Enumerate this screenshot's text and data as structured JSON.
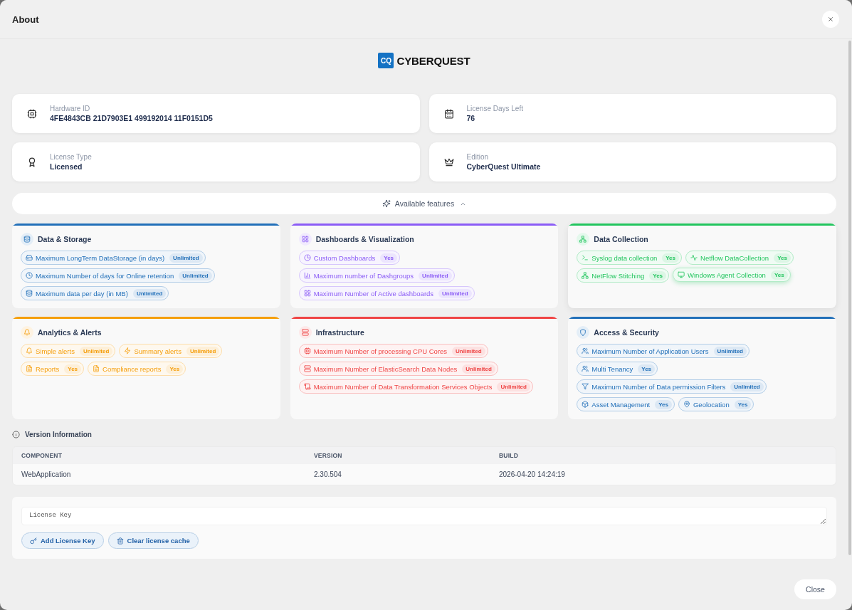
{
  "dialog": {
    "title": "About"
  },
  "logo": {
    "mark": "CQ",
    "name": "CYBERQUEST"
  },
  "info_cards": [
    {
      "kind": "chip",
      "label": "Hardware ID",
      "value": "4FE4843CB 21D7903E1 499192014 11F0151D5"
    },
    {
      "kind": "calendar",
      "label": "License Days Left",
      "value": "76"
    },
    {
      "kind": "ribbon",
      "label": "License Type",
      "value": "Licensed"
    },
    {
      "kind": "crown",
      "label": "Edition",
      "value": "CyberQuest Ultimate"
    }
  ],
  "features_toggle": {
    "label": "Available features",
    "expanded": true
  },
  "categories": [
    {
      "title": "Data & Storage",
      "kind": "database",
      "color": "#2270b9",
      "hovered": false,
      "features": [
        {
          "kind": "drive",
          "name": "Maximum LongTerm DataStorage (in days)",
          "value": "Unlimited",
          "hovered": false
        },
        {
          "kind": "clock",
          "name": "Maximum Number of days for Online retention",
          "value": "Unlimited",
          "hovered": false
        },
        {
          "kind": "database",
          "name": "Maximum data per day (in MB)",
          "value": "Unlimited",
          "hovered": false
        }
      ]
    },
    {
      "title": "Dashboards & Visualization",
      "kind": "grid",
      "color": "#8b5cf6",
      "hovered": false,
      "features": [
        {
          "kind": "pie",
          "name": "Custom Dashboards",
          "value": "Yes",
          "hovered": false
        },
        {
          "kind": "bars",
          "name": "Maximum number of Dashgroups",
          "value": "Unlimited",
          "hovered": false
        },
        {
          "kind": "grid",
          "name": "Maximum Number of Active dashboards",
          "value": "Unlimited",
          "hovered": false
        }
      ]
    },
    {
      "title": "Data Collection",
      "kind": "network",
      "color": "#22c55e",
      "hovered": true,
      "features": [
        {
          "kind": "terminal",
          "name": "Syslog data collection",
          "value": "Yes",
          "hovered": false
        },
        {
          "kind": "pulse",
          "name": "Netflow DataCollection",
          "value": "Yes",
          "hovered": false
        },
        {
          "kind": "network",
          "name": "NetFlow Stitching",
          "value": "Yes",
          "hovered": false
        },
        {
          "kind": "monitor",
          "name": "Windows Agent Collection",
          "value": "Yes",
          "hovered": true
        }
      ]
    },
    {
      "title": "Analytics & Alerts",
      "kind": "bell",
      "color": "#f59e0b",
      "hovered": false,
      "features": [
        {
          "kind": "bell",
          "name": "Simple alerts",
          "value": "Unlimited",
          "hovered": false
        },
        {
          "kind": "bolt",
          "name": "Summary alerts",
          "value": "Unlimited",
          "hovered": false
        },
        {
          "kind": "document",
          "name": "Reports",
          "value": "Yes",
          "hovered": false
        },
        {
          "kind": "document",
          "name": "Compliance reports",
          "value": "Yes",
          "hovered": false
        }
      ]
    },
    {
      "title": "Infrastructure",
      "kind": "server",
      "color": "#ef4444",
      "hovered": false,
      "features": [
        {
          "kind": "chip",
          "name": "Maximum Number of processing CPU Cores",
          "value": "Unlimited",
          "hovered": false
        },
        {
          "kind": "server",
          "name": "Maximum Number of ElasticSearch Data Nodes",
          "value": "Unlimited",
          "hovered": false
        },
        {
          "kind": "scroll",
          "name": "Maximum Number of Data Transformation Services Objects",
          "value": "Unlimited",
          "hovered": false
        }
      ]
    },
    {
      "title": "Access & Security",
      "kind": "shield",
      "color": "#2270b9",
      "hovered": false,
      "features": [
        {
          "kind": "users",
          "name": "Maximum Number of Application Users",
          "value": "Unlimited",
          "hovered": false
        },
        {
          "kind": "users",
          "name": "Multi Tenancy",
          "value": "Yes",
          "hovered": false
        },
        {
          "kind": "filter",
          "name": "Maximum Number of Data permission Filters",
          "value": "Unlimited",
          "hovered": false
        },
        {
          "kind": "cube",
          "name": "Asset Management",
          "value": "Yes",
          "hovered": false
        },
        {
          "kind": "pin",
          "name": "Geolocation",
          "value": "Yes",
          "hovered": false
        }
      ]
    }
  ],
  "version_info": {
    "title": "Version Information",
    "columns": [
      "COMPONENT",
      "VERSION",
      "BUILD"
    ],
    "rows": [
      [
        "WebApplication",
        "2.30.504",
        "2026-04-20 14:24:19"
      ]
    ]
  },
  "license": {
    "placeholder": "License Key",
    "buttons": [
      {
        "kind": "key",
        "label": "Add License Key"
      },
      {
        "kind": "trash",
        "label": "Clear license cache"
      }
    ]
  },
  "footer": {
    "close_label": "Close"
  }
}
